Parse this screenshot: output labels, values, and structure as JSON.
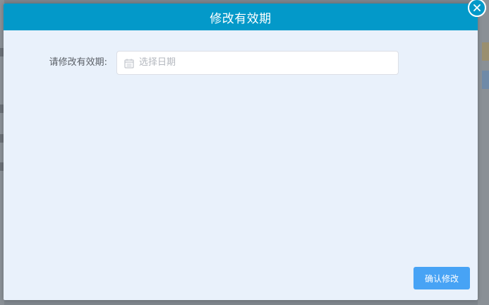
{
  "dialog": {
    "title": "修改有效期",
    "close_icon": "close-icon"
  },
  "form": {
    "expiry_label": "请修改有效期:",
    "date_placeholder": "选择日期",
    "date_value": "",
    "calendar_icon": "calendar-icon"
  },
  "actions": {
    "confirm_label": "确认修改"
  },
  "colors": {
    "header": "#0399c9",
    "dialog_body": "#e9f1fb",
    "confirm_button": "#47a3f5",
    "overlay": "#7e858c"
  }
}
